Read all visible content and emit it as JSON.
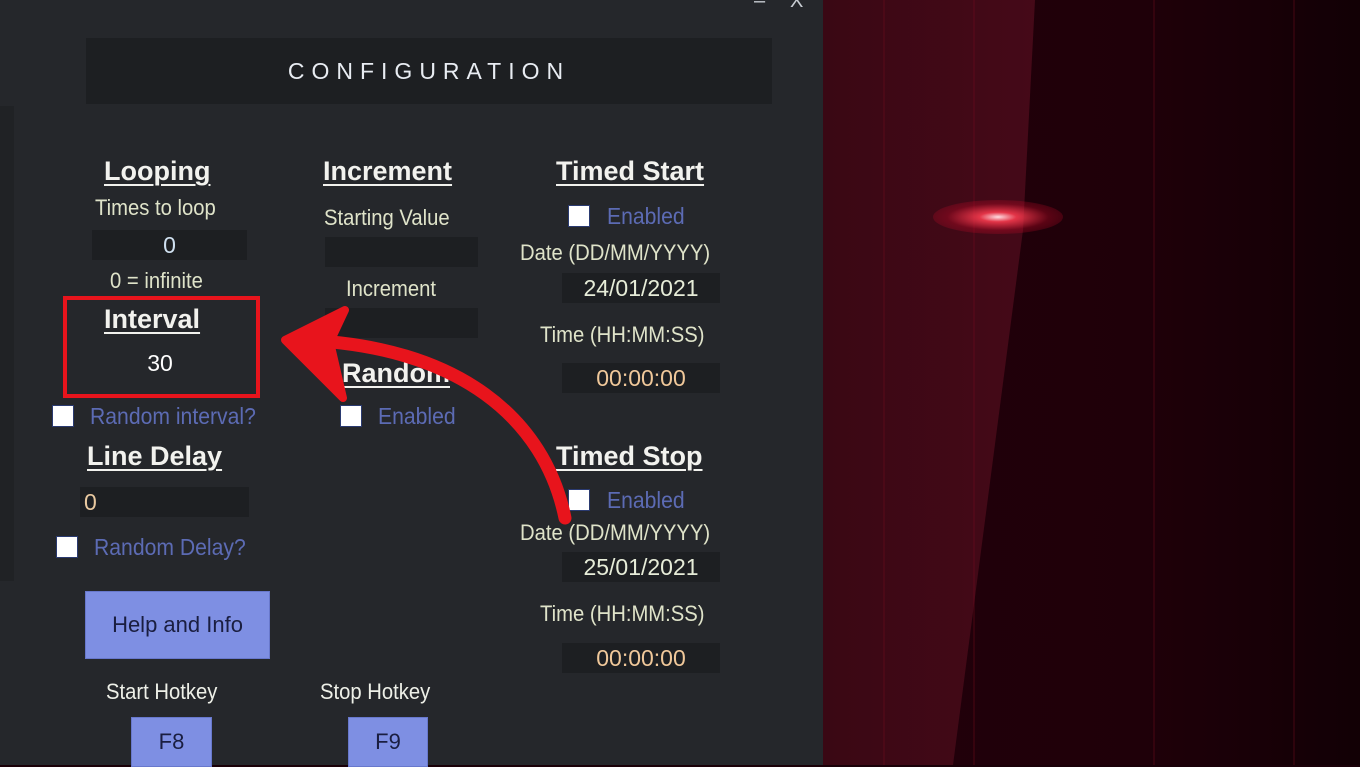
{
  "window": {
    "title": "CONFIGURATION",
    "controls": {
      "minimize": "–",
      "close": "X"
    }
  },
  "looping": {
    "heading": "Looping",
    "times_label": "Times to loop",
    "times_value": "0",
    "hint": "0 = infinite"
  },
  "interval": {
    "heading": "Interval",
    "value": "30",
    "random_label": "Random interval?",
    "random_checked": false
  },
  "line_delay": {
    "heading": "Line Delay",
    "value": "0",
    "random_label": "Random Delay?",
    "random_checked": false
  },
  "increment": {
    "heading": "Increment",
    "starting_label": "Starting Value",
    "starting_value": "",
    "increment_label": "Increment",
    "increment_value": ""
  },
  "random": {
    "heading": "Random",
    "enabled_label": "Enabled",
    "enabled_checked": false
  },
  "timed_start": {
    "heading": "Timed Start",
    "enabled_label": "Enabled",
    "enabled_checked": false,
    "date_label": "Date (DD/MM/YYYY)",
    "date_value": "24/01/2021",
    "time_label": "Time (HH:MM:SS)",
    "time_value": "00:00:00"
  },
  "timed_stop": {
    "heading": "Timed Stop",
    "enabled_label": "Enabled",
    "enabled_checked": false,
    "date_label": "Date (DD/MM/YYYY)",
    "date_value": "25/01/2021",
    "time_label": "Time (HH:MM:SS)",
    "time_value": "00:00:00"
  },
  "help_button": "Help and Info",
  "hotkeys": {
    "start_label": "Start Hotkey",
    "start_key": "F8",
    "stop_label": "Stop Hotkey",
    "stop_key": "F9"
  },
  "annotation": {
    "highlight_color": "#e8141c",
    "arrow_color": "#e8141c"
  },
  "colors": {
    "panel": "#25272b",
    "field": "#1d1f22",
    "button": "#7e8fe3",
    "checkbox_label": "#5c6bb4"
  }
}
